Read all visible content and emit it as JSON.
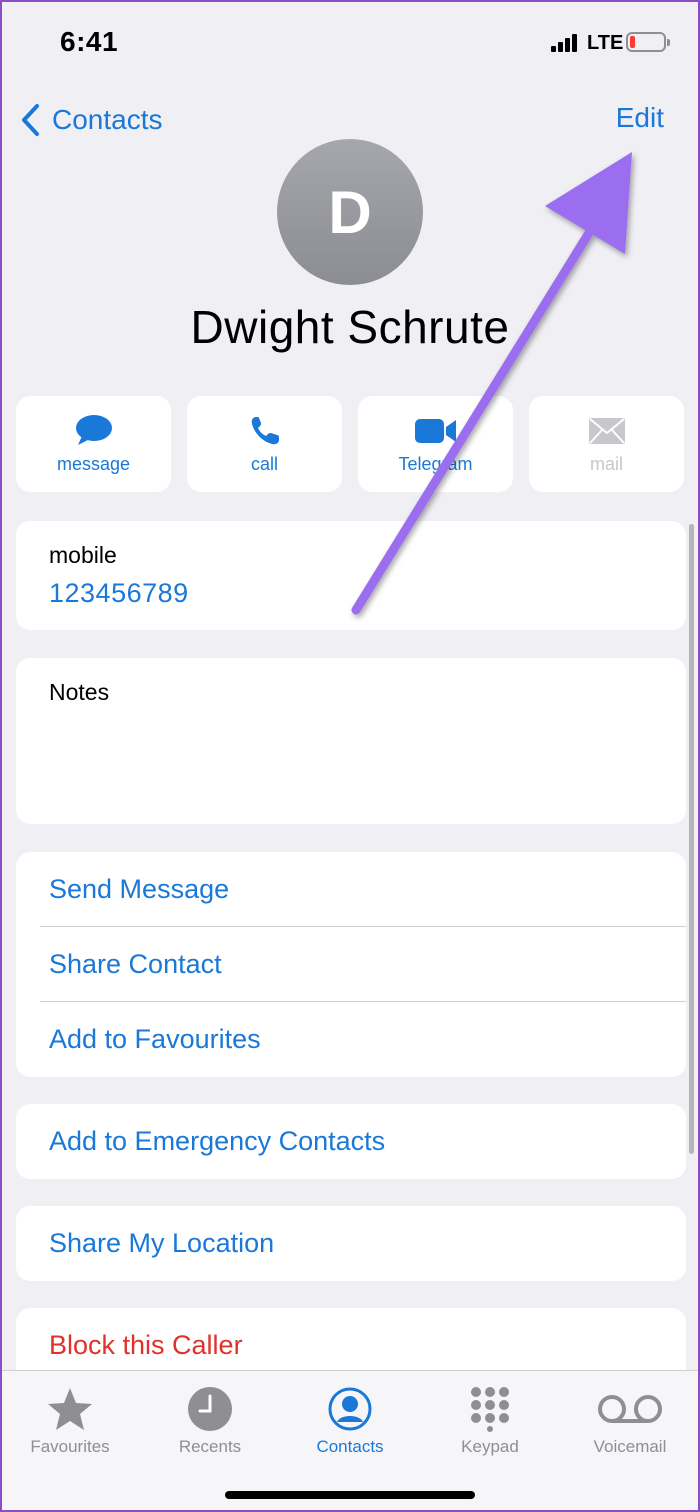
{
  "status_bar": {
    "time": "6:41",
    "network": "LTE"
  },
  "nav": {
    "back_label": "Contacts",
    "edit_label": "Edit"
  },
  "contact": {
    "initial": "D",
    "name": "Dwight Schrute"
  },
  "actions": [
    {
      "label": "message",
      "icon": "message-bubble-icon",
      "enabled": true
    },
    {
      "label": "call",
      "icon": "phone-icon",
      "enabled": true
    },
    {
      "label": "Telegram",
      "icon": "video-icon",
      "enabled": true
    },
    {
      "label": "mail",
      "icon": "envelope-icon",
      "enabled": false
    }
  ],
  "phone": {
    "label": "mobile",
    "value": "123456789"
  },
  "notes": {
    "label": "Notes"
  },
  "options": [
    "Send Message",
    "Share Contact",
    "Add to Favourites"
  ],
  "emergency": "Add to Emergency Contacts",
  "location": "Share My Location",
  "block": "Block this Caller",
  "tabs": [
    {
      "label": "Favourites",
      "icon": "star-icon",
      "active": false
    },
    {
      "label": "Recents",
      "icon": "clock-icon",
      "active": false
    },
    {
      "label": "Contacts",
      "icon": "person-circle-icon",
      "active": true
    },
    {
      "label": "Keypad",
      "icon": "keypad-icon",
      "active": false
    },
    {
      "label": "Voicemail",
      "icon": "voicemail-icon",
      "active": false
    }
  ],
  "colors": {
    "accent": "#1a78d8",
    "danger": "#e0312b",
    "annotation_arrow": "#9b6ef0"
  }
}
